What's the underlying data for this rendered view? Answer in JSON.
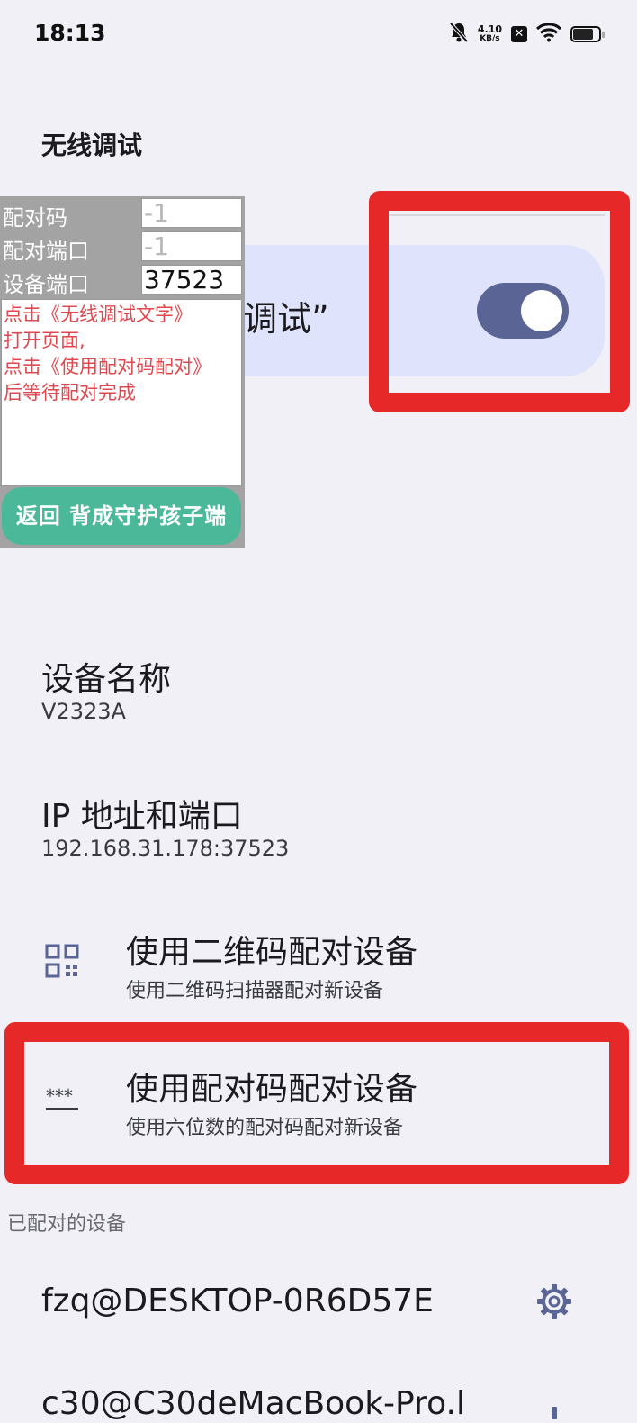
{
  "status_bar": {
    "time": "18:13",
    "net_speed_value": "4.10",
    "net_speed_unit": "KB/s",
    "icons": [
      "bell-muted-icon",
      "close-box-icon",
      "wifi-icon",
      "battery-icon"
    ]
  },
  "page": {
    "title": "无线调试"
  },
  "toggle_card": {
    "label_visible": "调试”",
    "enabled": true
  },
  "overlay": {
    "fields": [
      {
        "label": "配对码",
        "value": "-1",
        "placeholder": true
      },
      {
        "label": "配对端口",
        "value": "-1",
        "placeholder": true
      },
      {
        "label": "设备端口",
        "value": "37523",
        "placeholder": false
      }
    ],
    "note": "点击《无线调试文字》\n打开页面,\n点击《使用配对码配对》\n后等待配对完成",
    "button_label": "返回 背成守护孩子端"
  },
  "device_info": {
    "name_label": "设备名称",
    "name_value": "V2323A",
    "ip_label": "IP 地址和端口",
    "ip_value": "192.168.31.178:37523"
  },
  "pair_options": [
    {
      "title": "使用二维码配对设备",
      "subtitle": "使用二维码扫描器配对新设备",
      "icon": "qr-code-icon"
    },
    {
      "title": "使用配对码配对设备",
      "subtitle": "使用六位数的配对码配对新设备",
      "icon": "password-dots-icon"
    }
  ],
  "paired_devices": {
    "header": "已配对的设备",
    "items": [
      {
        "name": "fzq@DESKTOP-0R6D57E",
        "icon": "gear-icon"
      },
      {
        "name": "c30@C30deMacBook-Pro.l",
        "icon": "gear-icon"
      }
    ]
  },
  "colors": {
    "background": "#f0f0f6",
    "highlight_red": "#e62828",
    "toggle_on": "#5b6595",
    "toggle_card": "#dfe3fb",
    "overlay_button": "#4cb89a",
    "overlay_note_text": "#e0484f"
  }
}
